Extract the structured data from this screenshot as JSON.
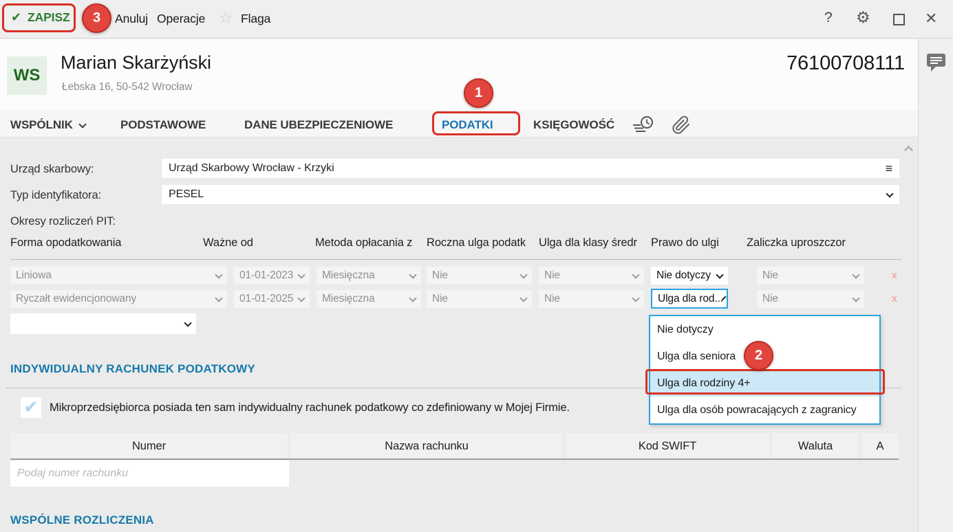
{
  "colors": {
    "annotation_red": "#d93025",
    "save_green": "#2e7d32",
    "active_tab_blue": "#1b74b4",
    "section_heading_blue": "#157aa8",
    "focus_border_blue": "#2ea3dc",
    "dropdown_highlight_blue": "#cde9f7"
  },
  "icons": {
    "save_check": "✔",
    "cancel_x": "✕",
    "flag_star": "☆",
    "help": "?",
    "settings": "⚙",
    "close": "✕",
    "menu": "≡"
  },
  "annotations": {
    "step_1": "1",
    "step_2": "2",
    "step_3": "3"
  },
  "toolbar": {
    "save": "ZAPISZ",
    "cancel": "Anuluj",
    "operations": "Operacje",
    "flag": "Flaga"
  },
  "header": {
    "initials": "WS",
    "name": "Marian Skarżyński",
    "address": "Łebska 16, 50-542 Wrocław",
    "identifier": "76100708111"
  },
  "tabs": {
    "wspolnik": "WSPÓLNIK",
    "podstawowe": "PODSTAWOWE",
    "dane_ubezpieczeniowe": "DANE UBEZPIECZENIOWE",
    "podatki": "PODATKI",
    "ksiegowosc": "KSIĘGOWOŚĆ"
  },
  "form": {
    "tax_office_label": "Urząd skarbowy:",
    "tax_office_value": "Urząd Skarbowy Wrocław - Krzyki",
    "id_type_label": "Typ identyfikatora:",
    "id_type_value": "PESEL",
    "pit_periods_label": "Okresy rozliczeń PIT:"
  },
  "pit_table": {
    "headers": [
      "Forma opodatkowania",
      "Ważne od",
      "Metoda opłacania z",
      "Roczna ulga podatk",
      "Ulga dla klasy średr",
      "Prawo do ulgi",
      "Zaliczka uproszczor"
    ],
    "remove_label": "x",
    "rows": [
      {
        "forma": "Liniowa",
        "wazne_od": "01-01-2023",
        "metoda": "Miesięczna",
        "roczna_ulga": "Nie",
        "ulga_klasy": "Nie",
        "prawo": "Nie dotyczy",
        "zaliczka": "Nie"
      },
      {
        "forma": "Ryczałt ewidencjonowany",
        "wazne_od": "01-01-2025",
        "metoda": "Miesięczna",
        "roczna_ulga": "Nie",
        "ulga_klasy": "Nie",
        "prawo": "Ulga dla rod...",
        "zaliczka": "Nie"
      }
    ]
  },
  "ulga_dropdown": {
    "options": [
      "Nie dotyczy",
      "Ulga dla seniora",
      "Ulga dla rodziny 4+",
      "Ulga dla osób powracających z zagranicy"
    ],
    "highlighted": "Ulga dla rodziny 4+"
  },
  "individual_account": {
    "title": "INDYWIDUALNY RACHUNEK PODATKOWY",
    "checkbox_checked": true,
    "checkbox_label": "Mikroprzedsiębiorca posiada ten sam indywidualny rachunek podatkowy co zdefiniowany w Mojej Firmie.",
    "bank_table_headers": [
      "Numer",
      "Nazwa rachunku",
      "Kod SWIFT",
      "Waluta",
      "A"
    ],
    "number_placeholder": "Podaj numer rachunku"
  },
  "joint_settlements": {
    "title": "WSPÓLNE ROZLICZENIA"
  }
}
